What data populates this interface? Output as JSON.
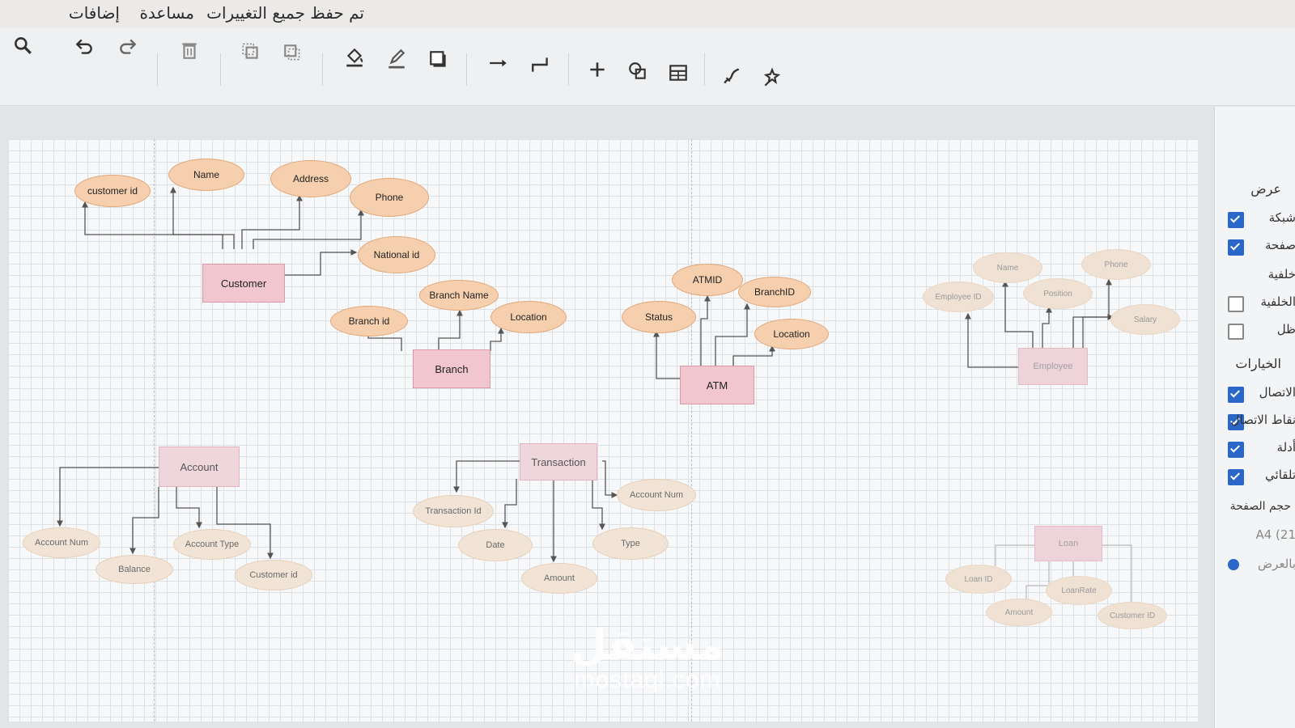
{
  "menubar": {
    "items": [
      "إضافات",
      "مساعدة"
    ],
    "status": "تم حفظ جميع التغييرات"
  },
  "toolbar": {
    "buttons": [
      "zoom-icon",
      "undo-icon",
      "redo-icon",
      "delete-icon",
      "to-front-icon",
      "to-back-icon",
      "fill-color-icon",
      "line-color-icon",
      "shadow-icon",
      "connection-arrow-icon",
      "waypoints-icon",
      "insert-plus-icon",
      "shapes-icon",
      "table-icon",
      "freehand-icon",
      "magic-icon"
    ]
  },
  "diagram": {
    "customer": {
      "entity": "Customer",
      "attrs": [
        "customer id",
        "Name",
        "Address",
        "Phone",
        "National id"
      ]
    },
    "branch": {
      "entity": "Branch",
      "attrs": [
        "Branch Name",
        "Branch id",
        "Location"
      ]
    },
    "atm": {
      "entity": "ATM",
      "attrs": [
        "ATMID",
        "BranchID",
        "Status",
        "Location"
      ]
    },
    "employee": {
      "entity": "Employee",
      "attrs": [
        "Name",
        "Phone",
        "Employee ID",
        "Position",
        "Salary"
      ]
    },
    "account": {
      "entity": "Account",
      "attrs": [
        "Account Num",
        "Balance",
        "Account Type",
        "Customer id"
      ]
    },
    "transaction": {
      "entity": "Transaction",
      "attrs": [
        "Transaction Id",
        "Account Num",
        "Date",
        "Type",
        "Amount"
      ]
    },
    "loan": {
      "entity": "Loan",
      "attrs": [
        "Loan ID",
        "Amount",
        "LoanRate",
        "Customer ID"
      ]
    }
  },
  "right_panel": {
    "view_heading": "عرض",
    "grid_label": "شبكة",
    "page_view_label": "صفحة",
    "background_label": "خلفية",
    "background_image_label": "الخلفية",
    "shadow_label": "ظل",
    "options_heading": "الخيارات",
    "connection_arrows_label": "الاتصال",
    "connection_points_label": "نقاط الاتصال",
    "guides_label": "أدلة",
    "auto_label": "تلقائي",
    "paper_size_heading": "حجم الصفحة",
    "paper_size_value": "A4 (21",
    "landscape_label": "بالعرض",
    "checks": {
      "grid": true,
      "page_view": true,
      "background_image": false,
      "shadow": false,
      "connection_arrows": true,
      "connection_points": true,
      "guides": true,
      "auto": true
    }
  },
  "watermark": {
    "arabic": "مستقل",
    "latin": "mostaql.com"
  },
  "colors": {
    "attribute_fill": "#f5cfae",
    "entity_fill": "#f2c6cf",
    "connector": "#555555",
    "checkbox": "#2a67c9"
  }
}
